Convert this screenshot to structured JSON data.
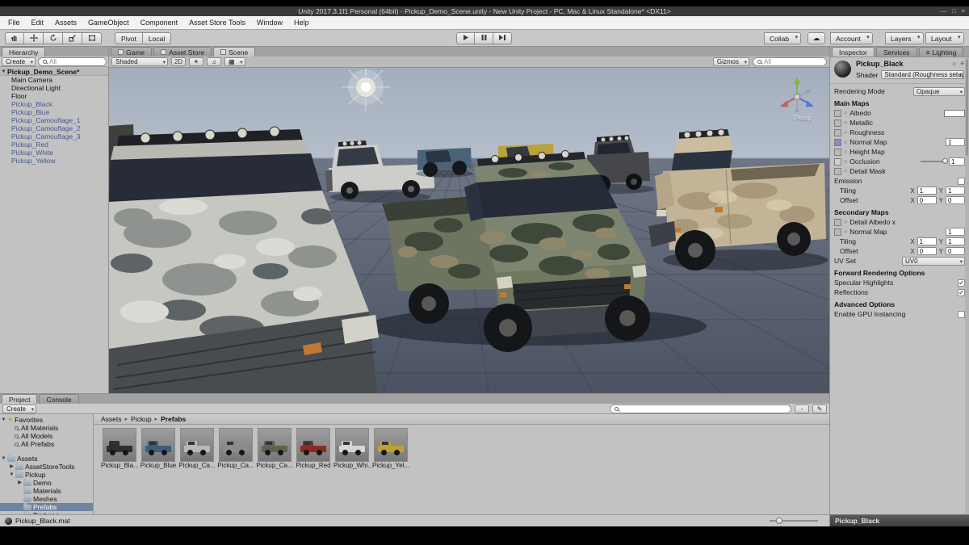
{
  "window": {
    "title": "Unity 2017.3.1f1 Personal (64bit) - Pickup_Demo_Scene.unity - New Unity Project - PC, Mac & Linux Standalone* <DX11>",
    "minimize": "—",
    "maximize": "□",
    "close": "×"
  },
  "menubar": {
    "items": [
      "File",
      "Edit",
      "Assets",
      "GameObject",
      "Component",
      "Asset Store Tools",
      "Window",
      "Help"
    ]
  },
  "toolbar": {
    "pivot": "Pivot",
    "local": "Local",
    "collab": "Collab",
    "cloud": "☁",
    "account": "Account",
    "layers": "Layers",
    "layout": "Layout"
  },
  "hierarchy": {
    "tab": "Hierarchy",
    "create": "Create",
    "search_filter": "All",
    "scene_root": "Pickup_Demo_Scene*",
    "items": [
      {
        "label": "Main Camera"
      },
      {
        "label": "Directional Light"
      },
      {
        "label": "Floor"
      },
      {
        "label": "Pickup_Black"
      },
      {
        "label": "Pickup_Blue"
      },
      {
        "label": "Pickup_Camouflage_1"
      },
      {
        "label": "Pickup_Camouflage_2"
      },
      {
        "label": "Pickup_Camouflage_3"
      },
      {
        "label": "Pickup_Red"
      },
      {
        "label": "Pickup_White"
      },
      {
        "label": "Pickup_Yellow"
      }
    ]
  },
  "scene_view": {
    "tab_game": "Game",
    "tab_asset_store": "Asset Store",
    "tab_scene": "Scene",
    "shaded": "Shaded",
    "two_d": "2D",
    "gizmos": "Gizmos",
    "search_filter": "All",
    "persp": "Persp",
    "colors": {
      "truck_camo_green": "#7d8571",
      "truck_camo_white": "#c6c7c1",
      "truck_tan": "#c3b498",
      "truck_white": "#cdcec9",
      "truck_blue": "#4a6379",
      "truck_yellow": "#b9a13c",
      "truck_dark": "#46474b"
    }
  },
  "inspector": {
    "tab_inspector": "Inspector",
    "tab_services": "Services",
    "tab_lighting": "Lighting",
    "material_name": "Pickup_Black",
    "shader_label": "Shader",
    "shader_value": "Standard (Roughness setup)",
    "rendering_mode_label": "Rendering Mode",
    "rendering_mode_value": "Opaque",
    "main_maps_header": "Main Maps",
    "albedo": "Albedo",
    "metallic": "Metallic",
    "roughness": "Roughness",
    "normal_map": "Normal Map",
    "normal_map_value": "1",
    "height_map": "Height Map",
    "occlusion": "Occlusion",
    "occlusion_value": "1",
    "detail_mask": "Detail Mask",
    "emission": "Emission",
    "tiling_label": "Tiling",
    "offset_label": "Offset",
    "x_label": "X",
    "y_label": "Y",
    "main_tiling_x": "1",
    "main_tiling_y": "1",
    "main_offset_x": "0",
    "main_offset_y": "0",
    "secondary_maps_header": "Secondary Maps",
    "detail_albedo": "Detail Albedo x",
    "sec_normal_map": "Normal Map",
    "sec_normal_value": "1",
    "sec_tiling_x": "1",
    "sec_tiling_y": "1",
    "sec_offset_x": "0",
    "sec_offset_y": "0",
    "uv_set_label": "UV Set",
    "uv_set_value": "UV0",
    "forward_header": "Forward Rendering Options",
    "specular_highlights": "Specular Highlights",
    "reflections": "Reflections",
    "check": "✓",
    "advanced_header": "Advanced Options",
    "gpu_instancing": "Enable GPU Instancing",
    "footer": "Pickup_Black"
  },
  "project": {
    "tab_project": "Project",
    "tab_console": "Console",
    "create": "Create",
    "favorites": "Favorites",
    "fav_items": [
      "All Materials",
      "All Models",
      "All Prefabs"
    ],
    "assets_root": "Assets",
    "tree": [
      {
        "label": "AssetStoreTools"
      },
      {
        "label": "Pickup"
      },
      {
        "label": "Demo"
      },
      {
        "label": "Materials"
      },
      {
        "label": "Meshes"
      },
      {
        "label": "Prefabs"
      },
      {
        "label": "Textures"
      }
    ],
    "breadcrumb": {
      "root": "Assets",
      "sep": "▸",
      "mid": "Pickup",
      "leaf": "Prefabs"
    },
    "items": [
      {
        "label": "Pickup_Bla...",
        "color": "#2f2f2f"
      },
      {
        "label": "Pickup_Blue",
        "color": "#3d5c7e"
      },
      {
        "label": "Pickup_Ca...",
        "color": "#b8b9b1"
      },
      {
        "label": "Pickup_Ca...",
        "color": "#8c8d85"
      },
      {
        "label": "Pickup_Ca...",
        "color": "#5c664f"
      },
      {
        "label": "Pickup_Red",
        "color": "#8d2a22"
      },
      {
        "label": "Pickup_Whi...",
        "color": "#d5d5d1"
      },
      {
        "label": "Pickup_Yel...",
        "color": "#c1a12d"
      }
    ],
    "status_file": "Pickup_Black.mat"
  }
}
